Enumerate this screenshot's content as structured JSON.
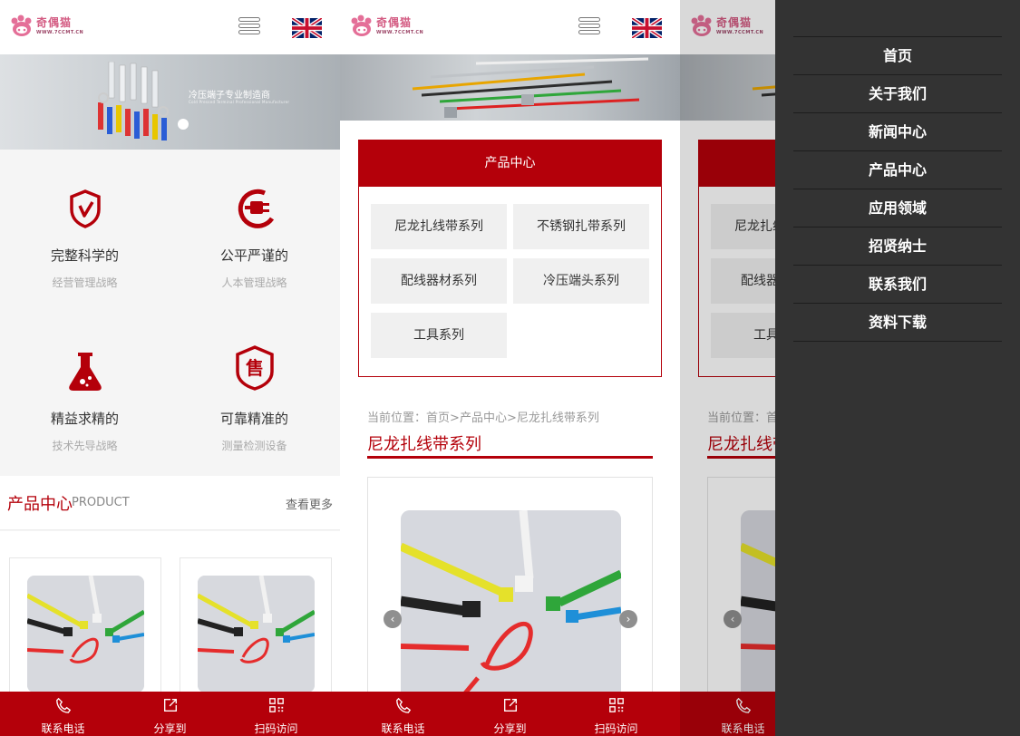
{
  "brand": {
    "name": "奇偶猫",
    "url": "WWW.7CCMT.CN"
  },
  "banner": {
    "tagline": "冷压端子专业制造商",
    "subline": "Cold Pressed Terminal Professional Manufacturer"
  },
  "features": [
    {
      "title": "完整科学的",
      "subtitle": "经营管理战略",
      "icon": "shield-check-icon"
    },
    {
      "title": "公平严谨的",
      "subtitle": "人本管理战略",
      "icon": "plug-icon"
    },
    {
      "title": "精益求精的",
      "subtitle": "技术先导战略",
      "icon": "flask-icon"
    },
    {
      "title": "可靠精准的",
      "subtitle": "测量检测设备",
      "icon": "sale-badge-icon"
    }
  ],
  "product_center": {
    "title_cn": "产品中心",
    "title_en": "PRODUCT",
    "more": "查看更多"
  },
  "bottom_bar": [
    {
      "label": "联系电话",
      "icon": "phone-icon"
    },
    {
      "label": "分享到",
      "icon": "share-icon"
    },
    {
      "label": "扫码访问",
      "icon": "qrcode-icon"
    }
  ],
  "category_box": {
    "title": "产品中心",
    "items": [
      "尼龙扎线带系列",
      "不锈钢扎带系列",
      "配线器材系列",
      "冷压端头系列",
      "工具系列"
    ]
  },
  "breadcrumb": {
    "prefix": "当前位置：",
    "home": "首页",
    "sep": ">",
    "parent": "产品中心",
    "current": "尼龙扎线带系列"
  },
  "section_title": "尼龙扎线带系列",
  "gallery": {
    "prev": "‹",
    "next": "›"
  },
  "drawer_menu": [
    "首页",
    "关于我们",
    "新闻中心",
    "产品中心",
    "应用领域",
    "招贤纳士",
    "联系我们",
    "资料下载"
  ],
  "colors": {
    "accent": "#b4000a",
    "drawer": "#333333"
  }
}
